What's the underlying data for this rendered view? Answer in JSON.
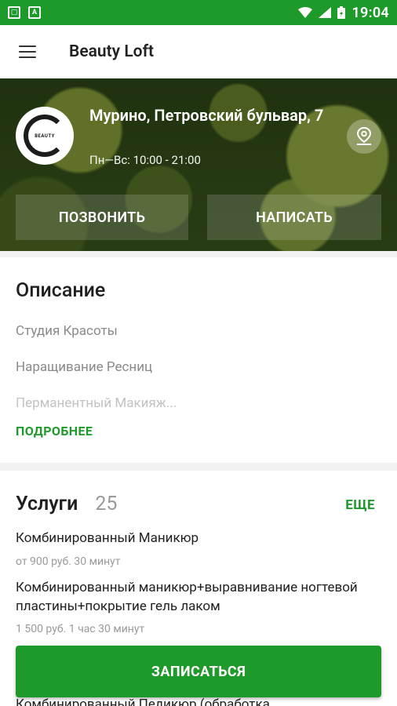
{
  "status_bar": {
    "time": "19:04",
    "icons": [
      "image-icon",
      "a-icon",
      "wifi-icon",
      "signal-icon",
      "battery-icon"
    ]
  },
  "app_bar": {
    "title": "Beauty Loft",
    "menu_icon": "hamburger-menu-icon"
  },
  "hero": {
    "logo_text": "BEAUTY",
    "address": "Мурино, Петровский бульвар, 7",
    "hours": "Пн—Вс: 10:00 - 21:00",
    "call_label": "ПОЗВОНИТЬ",
    "message_label": "НАПИСАТЬ"
  },
  "description": {
    "title": "Описание",
    "lines": [
      "Студия Красоты",
      "Наращивание Ресниц",
      "Перманентный Макияж..."
    ],
    "more_label": "ПОДРОБНЕЕ"
  },
  "services": {
    "title": "Услуги",
    "count": "25",
    "all_label": "ЕЩЕ",
    "items": [
      {
        "name": "Комбинированный Маникюр",
        "meta": "от 900 руб.  30 минут"
      },
      {
        "name": "Комбинированный маникюр+выравнивание ногтевой пластины+покрытие гель лаком",
        "meta": "1 500 руб.  1 час 30 минут"
      },
      {
        "name": "Комбинированный Педикюр (обработка"
      }
    ]
  },
  "book_button": {
    "label": "ЗАПИСАТЬСЯ"
  },
  "colors": {
    "primary": "#1e9a2a",
    "muted_text": "#9a9a9a"
  }
}
